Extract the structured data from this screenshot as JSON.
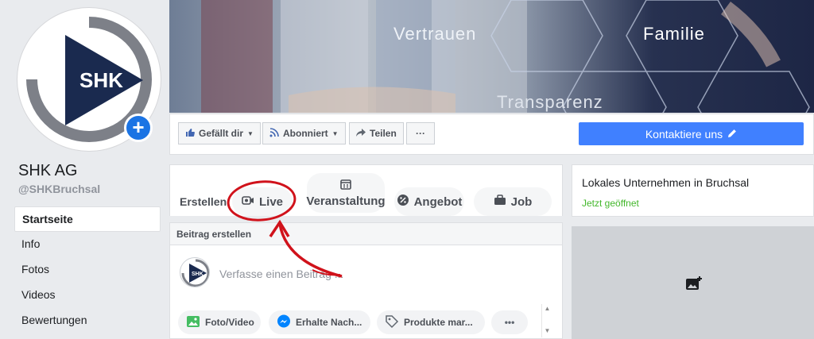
{
  "profile": {
    "name": "SHK AG",
    "handle": "@SHKBruchsal",
    "logo_text": "SHK",
    "add_photo_icon": "plus-icon"
  },
  "nav": {
    "items": [
      {
        "label": "Startseite",
        "active": true
      },
      {
        "label": "Info",
        "active": false
      },
      {
        "label": "Fotos",
        "active": false
      },
      {
        "label": "Videos",
        "active": false
      },
      {
        "label": "Bewertungen",
        "active": false
      }
    ]
  },
  "cover": {
    "words": [
      "Vertrauen",
      "Familie",
      "Transparenz"
    ]
  },
  "action_bar": {
    "like_label": "Gefällt dir",
    "follow_label": "Abonniert",
    "share_label": "Teilen",
    "more_label": "···",
    "contact_label": "Kontaktiere uns"
  },
  "create": {
    "label": "Erstellen",
    "live": "Live",
    "event": "Veranstaltung",
    "offer": "Angebot",
    "job": "Job"
  },
  "post": {
    "header": "Beitrag erstellen",
    "placeholder": "Verfasse einen Beitrag ...",
    "actions": {
      "photo": "Foto/Video",
      "messages": "Erhalte Nach...",
      "products": "Produkte mar...",
      "more": "•••"
    }
  },
  "info": {
    "category": "Lokales Unternehmen in Bruchsal",
    "status": "Jetzt geöffnet"
  },
  "colors": {
    "accent": "#4080ff",
    "brand_navy": "#1a2a4f",
    "open_green": "#42b72a",
    "annotation_red": "#d0121b"
  }
}
